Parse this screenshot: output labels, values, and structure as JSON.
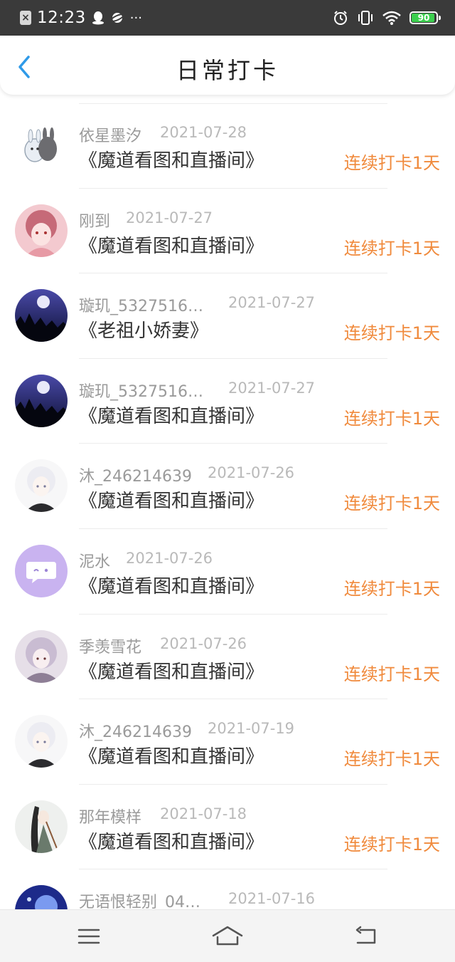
{
  "status_bar": {
    "time": "12:23",
    "battery": "90",
    "icons": [
      "notification-icon",
      "qq-icon",
      "planet-icon",
      "more-dots-icon",
      "alarm-icon",
      "vibrate-icon",
      "wifi-icon",
      "battery-icon"
    ]
  },
  "header": {
    "title": "日常打卡",
    "back_icon": "chevron-left-icon",
    "accent_color": "#2f9ae8"
  },
  "checkins": [
    {
      "name": "依星墨汐",
      "date": "2021-07-28",
      "book": "《魔道看图和直播间》",
      "streak": "连续打卡1天",
      "avatar": "bunny-cartoon"
    },
    {
      "name": "刚到",
      "date": "2021-07-27",
      "book": "《魔道看图和直播间》",
      "streak": "连续打卡1天",
      "avatar": "pink-anime-girl"
    },
    {
      "name": "璇玑_5327516…",
      "date": "2021-07-27",
      "book": "《老祖小娇妻》",
      "streak": "连续打卡1天",
      "avatar": "night-moon-forest"
    },
    {
      "name": "璇玑_5327516…",
      "date": "2021-07-27",
      "book": "《魔道看图和直播间》",
      "streak": "连续打卡1天",
      "avatar": "night-moon-forest"
    },
    {
      "name": "沐_246214639",
      "date": "2021-07-26",
      "book": "《魔道看图和直播间》",
      "streak": "连续打卡1天",
      "avatar": "white-hair-anime-boy"
    },
    {
      "name": "泥水",
      "date": "2021-07-26",
      "book": "《魔道看图和直播间》",
      "streak": "连续打卡1天",
      "avatar": "purple-chat-bubble"
    },
    {
      "name": "季羡雪花",
      "date": "2021-07-26",
      "book": "《魔道看图和直播间》",
      "streak": "连续打卡1天",
      "avatar": "anime-girl-lavender"
    },
    {
      "name": "沐_246214639",
      "date": "2021-07-19",
      "book": "《魔道看图和直播间》",
      "streak": "连续打卡1天",
      "avatar": "white-hair-anime-boy"
    },
    {
      "name": "那年模样",
      "date": "2021-07-18",
      "book": "《魔道看图和直播间》",
      "streak": "连续打卡1天",
      "avatar": "anime-swordsman"
    },
    {
      "name": "无语恨轻别_04…",
      "date": "2021-07-16",
      "book": "",
      "streak": "",
      "avatar": "blue-starry"
    }
  ],
  "colors": {
    "streak": "#f08a3c",
    "name": "#9a9a9a",
    "date": "#b9b9b9",
    "book": "#333333"
  },
  "nav_bar": {
    "icons": [
      "menu-icon",
      "home-icon",
      "back-icon"
    ]
  }
}
